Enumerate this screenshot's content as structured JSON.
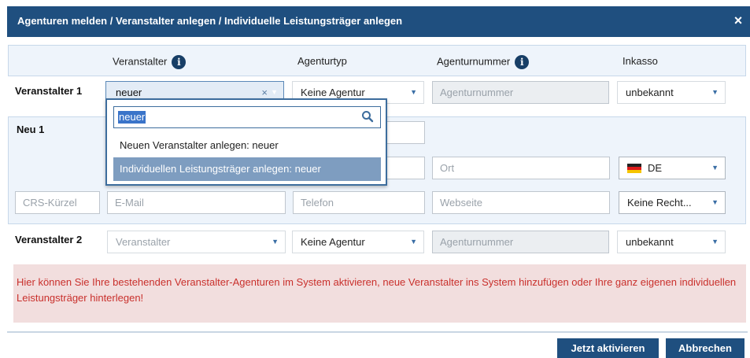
{
  "dialog": {
    "title": "Agenturen melden / Veranstalter anlegen / Individuelle Leistungsträger anlegen",
    "close_glyph": "×"
  },
  "columns": {
    "veranstalter": "Veranstalter",
    "agenturtyp": "Agenturtyp",
    "agenturnummer": "Agenturnummer",
    "inkasso": "Inkasso",
    "info_glyph": "i"
  },
  "row1": {
    "label": "Veranstalter 1",
    "veranstalter_value": "neuer",
    "clear_glyph": "×",
    "agenturtyp": "Keine Agentur",
    "agenturnummer_placeholder": "Agenturnummer",
    "inkasso": "unbekannt"
  },
  "dropdown": {
    "query": "neuer",
    "items": [
      {
        "label": "Neuen Veranstalter anlegen: neuer"
      },
      {
        "label": "Individuellen Leistungsträger anlegen: neuer"
      }
    ]
  },
  "neu": {
    "label": "Neu 1",
    "ort_placeholder": "Ort",
    "country": "DE",
    "crs_placeholder": "CRS-Kürzel",
    "email_placeholder": "E-Mail",
    "telefon_placeholder": "Telefon",
    "webseite_placeholder": "Webseite",
    "rechte": "Keine Recht..."
  },
  "row2": {
    "label": "Veranstalter 2",
    "veranstalter_placeholder": "Veranstalter",
    "agenturtyp": "Keine Agentur",
    "agenturnummer_placeholder": "Agenturnummer",
    "inkasso": "unbekannt"
  },
  "info_text": "Hier können Sie Ihre bestehenden Veranstalter-Agenturen im System aktivieren, neue Veranstalter ins System hinzufügen oder Ihre ganz eigenen individuellen Leistungsträger hinterlegen!",
  "buttons": {
    "activate": "Jetzt aktivieren",
    "cancel": "Abbrechen"
  },
  "colors": {
    "primary": "#1f4f7f",
    "band": "#eef4fb",
    "highlight": "#7e9dc0",
    "info_bg": "#f2dede",
    "info_text": "#c9302c"
  }
}
